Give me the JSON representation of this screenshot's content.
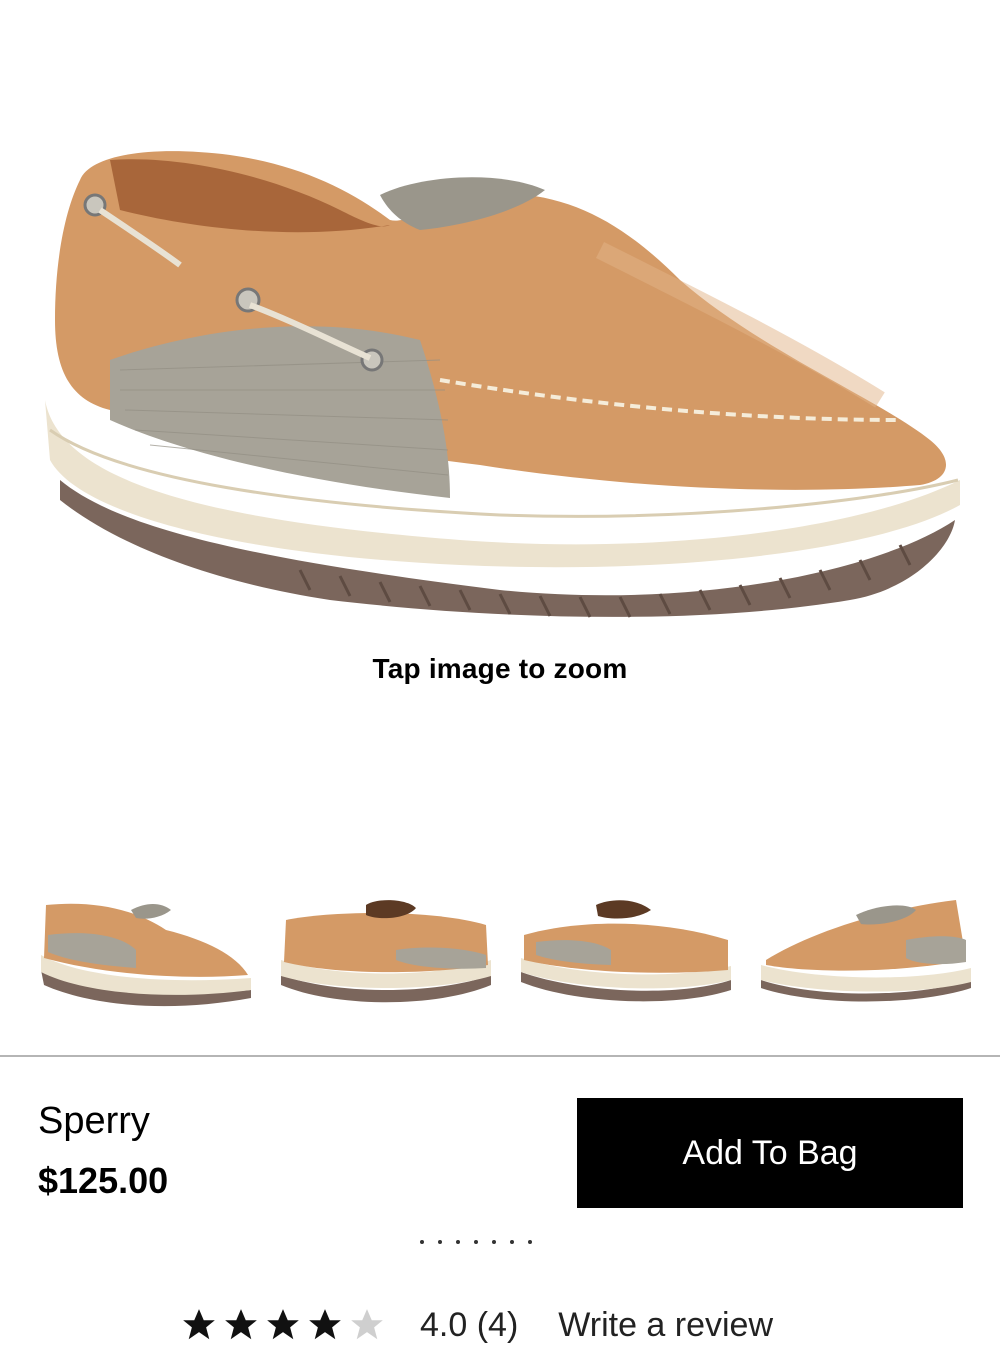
{
  "gallery": {
    "zoom_hint": "Tap image to zoom",
    "thumbnail_count": 4
  },
  "product": {
    "brand": "Sperry",
    "price": "$125.00"
  },
  "buybar": {
    "add_to_bag_label": "Add To Bag"
  },
  "reviews": {
    "rating_text": "4.0 (4)",
    "write_review_label": "Write a review",
    "stars_filled": 4,
    "stars_total": 5
  },
  "colors": {
    "leather": "#d49a66",
    "leather_dark": "#b97b48",
    "sole_cream": "#ece3cf",
    "sole_brown": "#7b665c",
    "mesh": "#a7a398",
    "button_bg": "#000000"
  }
}
